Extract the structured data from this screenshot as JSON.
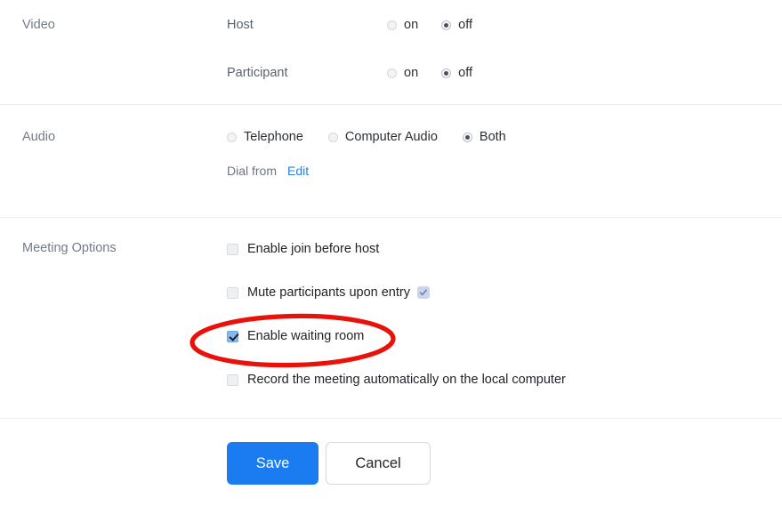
{
  "sections": {
    "video": {
      "label": "Video",
      "rows": [
        {
          "label": "Host",
          "options": [
            {
              "label": "on",
              "selected": false
            },
            {
              "label": "off",
              "selected": true
            }
          ]
        },
        {
          "label": "Participant",
          "options": [
            {
              "label": "on",
              "selected": false
            },
            {
              "label": "off",
              "selected": true
            }
          ]
        }
      ]
    },
    "audio": {
      "label": "Audio",
      "options": [
        {
          "label": "Telephone",
          "selected": false
        },
        {
          "label": "Computer Audio",
          "selected": false
        },
        {
          "label": "Both",
          "selected": true
        }
      ],
      "dial_label": "Dial from",
      "dial_edit_link": "Edit"
    },
    "meeting_options": {
      "label": "Meeting Options",
      "items": [
        {
          "label": "Enable join before host",
          "checked": false,
          "badge": null
        },
        {
          "label": "Mute participants upon entry",
          "checked": false,
          "badge": "info-badge-icon"
        },
        {
          "label": "Enable waiting room",
          "checked": true,
          "badge": null,
          "highlighted": true
        },
        {
          "label": "Record the meeting automatically on the local computer",
          "checked": false,
          "badge": null
        }
      ]
    },
    "actions": {
      "save_label": "Save",
      "cancel_label": "Cancel"
    }
  },
  "annotation": {
    "type": "ellipse-highlight",
    "color": "#e8120b",
    "target": "Enable waiting room"
  },
  "colors": {
    "accent_blue": "#1a7cf0",
    "link_blue": "#2a7fe0",
    "checkbox_checked": "#83b9ef",
    "annotation_red": "#e8120b",
    "section_label_gray": "#747a87",
    "divider": "#eceef0"
  }
}
